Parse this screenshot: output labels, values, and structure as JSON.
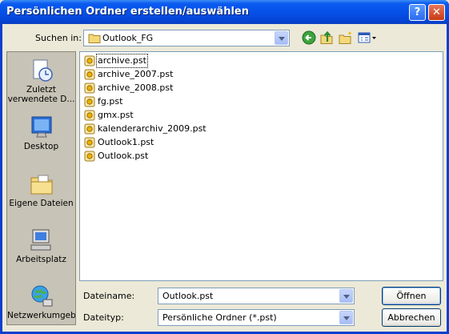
{
  "window": {
    "title": "Persönlichen Ordner erstellen/auswählen",
    "help_glyph": "?",
    "close_glyph": "✕"
  },
  "lookin": {
    "label": "Suchen in:",
    "value": "Outlook_FG"
  },
  "toolbar": {
    "icons": [
      "back-icon",
      "up-folder-icon",
      "new-folder-icon",
      "view-menu-icon"
    ]
  },
  "places": [
    {
      "label": "Zuletzt verwendete D...",
      "label_line1": "Zuletzt",
      "label_line2": "verwendete D...",
      "icon": "recent-documents-icon"
    },
    {
      "label": "Desktop",
      "icon": "desktop-icon"
    },
    {
      "label": "Eigene Dateien",
      "icon": "my-documents-icon"
    },
    {
      "label": "Arbeitsplatz",
      "icon": "my-computer-icon"
    },
    {
      "label": "Netzwerkumgeb",
      "icon": "network-icon"
    }
  ],
  "files": [
    {
      "name": "archive.pst"
    },
    {
      "name": "archive_2007.pst"
    },
    {
      "name": "archive_2008.pst"
    },
    {
      "name": "fg.pst"
    },
    {
      "name": "gmx.pst"
    },
    {
      "name": "kalenderarchiv_2009.pst"
    },
    {
      "name": "Outlook1.pst"
    },
    {
      "name": "Outlook.pst"
    }
  ],
  "filename": {
    "label": "Dateiname:",
    "value": "Outlook.pst"
  },
  "filetype": {
    "label": "Dateityp:",
    "value": "Persönliche Ordner (*.pst)"
  },
  "buttons": {
    "open": "Öffnen",
    "cancel": "Abbrechen"
  }
}
